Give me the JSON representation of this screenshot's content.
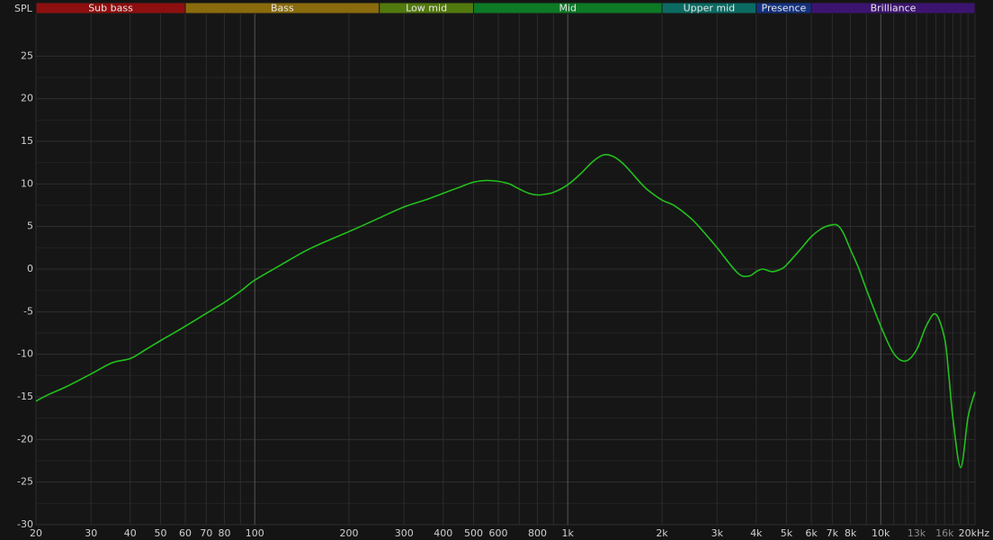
{
  "chart_data": {
    "type": "line",
    "x_scale": "log",
    "ylabel": "SPL",
    "ylim": [
      -30,
      30
    ],
    "xlim": [
      20,
      20000
    ],
    "grid": true,
    "bands": [
      {
        "label": "Sub bass",
        "from": 20,
        "to": 60,
        "color": "#8e0f0f"
      },
      {
        "label": "Bass",
        "from": 60,
        "to": 250,
        "color": "#8a6b0c"
      },
      {
        "label": "Low mid",
        "from": 250,
        "to": 500,
        "color": "#52790e"
      },
      {
        "label": "Mid",
        "from": 500,
        "to": 2000,
        "color": "#0d7a26"
      },
      {
        "label": "Upper mid",
        "from": 2000,
        "to": 4000,
        "color": "#0b6b63"
      },
      {
        "label": "Presence",
        "from": 4000,
        "to": 6000,
        "color": "#14317e"
      },
      {
        "label": "Brilliance",
        "from": 6000,
        "to": 20000,
        "color": "#3c1470"
      }
    ],
    "y_ticks": [
      {
        "value": 25,
        "label": "25"
      },
      {
        "value": 20,
        "label": "20"
      },
      {
        "value": 15,
        "label": "15"
      },
      {
        "value": 10,
        "label": "10"
      },
      {
        "value": 5,
        "label": "5"
      },
      {
        "value": 0,
        "label": "0"
      },
      {
        "value": -5,
        "label": "-5"
      },
      {
        "value": -10,
        "label": "-10"
      },
      {
        "value": -15,
        "label": "-15"
      },
      {
        "value": -20,
        "label": "-20"
      },
      {
        "value": -25,
        "label": "-25"
      },
      {
        "value": -30,
        "label": "-30"
      }
    ],
    "x_ticks": [
      {
        "value": 20,
        "label": "20"
      },
      {
        "value": 30,
        "label": "30"
      },
      {
        "value": 40,
        "label": "40"
      },
      {
        "value": 50,
        "label": "50"
      },
      {
        "value": 60,
        "label": "60"
      },
      {
        "value": 70,
        "label": "70"
      },
      {
        "value": 80,
        "label": "80"
      },
      {
        "value": 100,
        "label": "100"
      },
      {
        "value": 200,
        "label": "200"
      },
      {
        "value": 300,
        "label": "300"
      },
      {
        "value": 400,
        "label": "400"
      },
      {
        "value": 500,
        "label": "500"
      },
      {
        "value": 600,
        "label": "600"
      },
      {
        "value": 800,
        "label": "800"
      },
      {
        "value": 1000,
        "label": "1k"
      },
      {
        "value": 2000,
        "label": "2k"
      },
      {
        "value": 3000,
        "label": "3k"
      },
      {
        "value": 4000,
        "label": "4k"
      },
      {
        "value": 5000,
        "label": "5k"
      },
      {
        "value": 6000,
        "label": "6k"
      },
      {
        "value": 7000,
        "label": "7k"
      },
      {
        "value": 8000,
        "label": "8k"
      },
      {
        "value": 10000,
        "label": "10k"
      },
      {
        "value": 13000,
        "label": "13k",
        "dim": true
      },
      {
        "value": 16000,
        "label": "16k",
        "dim": true
      },
      {
        "value": 20000,
        "label": "20kHz"
      }
    ],
    "minor_grid_x": [
      20,
      30,
      40,
      50,
      60,
      70,
      80,
      90,
      200,
      300,
      400,
      500,
      600,
      700,
      800,
      900,
      2000,
      3000,
      4000,
      5000,
      6000,
      7000,
      8000,
      9000,
      11000,
      12000,
      13000,
      14000,
      15000,
      16000,
      17000,
      18000,
      19000,
      20000
    ],
    "major_grid_x": [
      100,
      1000,
      10000
    ],
    "series": [
      {
        "color": "#22c01d",
        "x": [
          20,
          22,
          25,
          30,
          35,
          40,
          45,
          50,
          60,
          70,
          80,
          90,
          100,
          120,
          150,
          200,
          250,
          300,
          350,
          400,
          450,
          500,
          550,
          600,
          650,
          700,
          750,
          800,
          850,
          900,
          1000,
          1100,
          1200,
          1300,
          1400,
          1500,
          1600,
          1700,
          1800,
          2000,
          2200,
          2500,
          2800,
          3000,
          3500,
          3800,
          4000,
          4200,
          4500,
          4800,
          5000,
          5500,
          6000,
          6500,
          7000,
          7300,
          7600,
          8000,
          8500,
          9000,
          10000,
          11000,
          12000,
          13000,
          14000,
          15000,
          16000,
          16500,
          17000,
          18000,
          19000,
          20000
        ],
        "y": [
          -15.5,
          -14.7,
          -13.8,
          -12.3,
          -11.0,
          -10.5,
          -9.4,
          -8.4,
          -6.7,
          -5.2,
          -3.9,
          -2.6,
          -1.3,
          0.4,
          2.4,
          4.4,
          6.0,
          7.3,
          8.1,
          8.9,
          9.6,
          10.2,
          10.4,
          10.3,
          10.0,
          9.4,
          8.9,
          8.7,
          8.8,
          9.0,
          9.9,
          11.2,
          12.6,
          13.4,
          13.2,
          12.4,
          11.3,
          10.2,
          9.3,
          8.1,
          7.4,
          5.8,
          3.8,
          2.5,
          -0.5,
          -0.8,
          -0.3,
          0.0,
          -0.3,
          0.0,
          0.5,
          2.2,
          3.8,
          4.8,
          5.2,
          5.1,
          4.2,
          2.3,
          0.1,
          -2.4,
          -6.7,
          -9.9,
          -10.8,
          -9.5,
          -6.6,
          -5.3,
          -8.2,
          -12.5,
          -17.5,
          -23.3,
          -17.4,
          -14.4
        ]
      }
    ]
  }
}
